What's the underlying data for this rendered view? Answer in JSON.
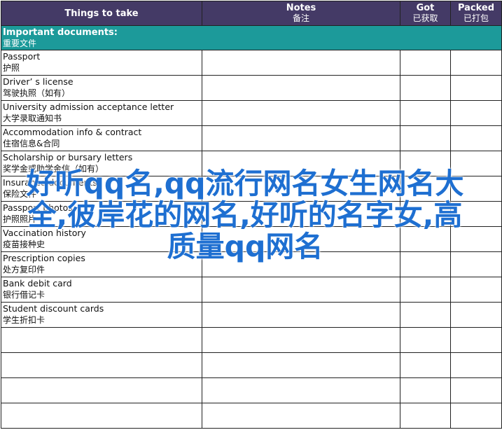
{
  "header": {
    "col1": "Things to take",
    "col2_en": "Notes",
    "col2_zh": "备注",
    "col3_en": "Got",
    "col3_zh": "已获取",
    "col4_en": "Packed",
    "col4_zh": "已打包"
  },
  "section": {
    "title_en": "Important documents:",
    "title_zh": "重要文件"
  },
  "items": [
    {
      "en": "Passport",
      "zh": "护照"
    },
    {
      "en": "Driver’ s license",
      "zh": "驾驶执照（如有）"
    },
    {
      "en": "University admission acceptance letter",
      "zh": "大学录取通知书"
    },
    {
      "en": "Accommodation info & contract",
      "zh": "住宿信息&合同"
    },
    {
      "en": "Scholarship or bursary letters",
      "zh": "奖学金或助学金信（如有）"
    },
    {
      "en": "Insurance documents",
      "zh": "保险文件"
    },
    {
      "en": "Passport photos",
      "zh": "护照照片"
    },
    {
      "en": "Vaccination history",
      "zh": "疫苗接种史"
    },
    {
      "en": "Prescription copies",
      "zh": "处方复印件"
    },
    {
      "en": "Bank debit card",
      "zh": "银行借记卡"
    },
    {
      "en": "Student discount cards",
      "zh": "学生折扣卡"
    }
  ],
  "watermark": "好听qq名,qq流行网名女生网名大全,彼岸花的网名,好听的名字女,高质量qq网名",
  "colors": {
    "header_bg": "#443a66",
    "section_bg": "#1c9a9a",
    "watermark": "#1e6fd1"
  }
}
